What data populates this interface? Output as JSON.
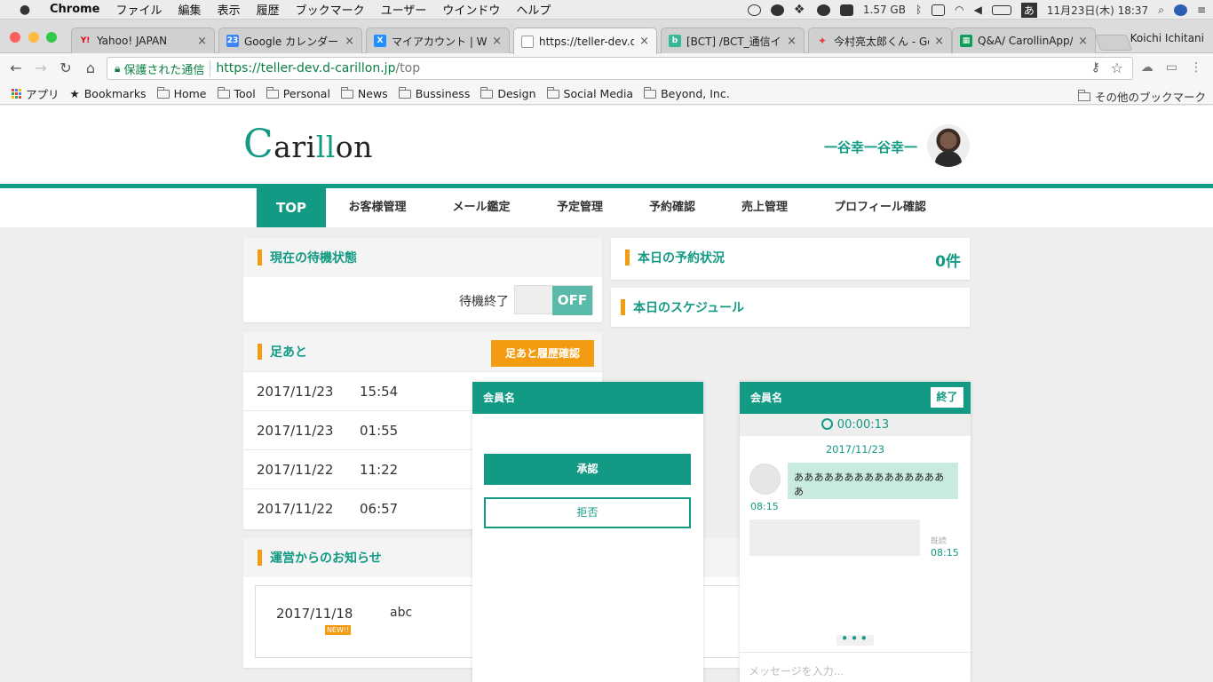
{
  "menubar": {
    "items": [
      "Chrome",
      "ファイル",
      "編集",
      "表示",
      "履歴",
      "ブックマーク",
      "ユーザー",
      "ウインドウ",
      "ヘルプ"
    ],
    "memory": "1.57 GB",
    "ime": "あ",
    "datetime": "11月23日(木)  18:37"
  },
  "tabs": [
    {
      "title": "Yahoo! JAPAN",
      "fav_color": "#e60012",
      "fav_text": "Y!"
    },
    {
      "title": "Google カレンダー - ",
      "fav_color": "#4285f4",
      "fav_text": "23"
    },
    {
      "title": "マイアカウント | Wix",
      "fav_color": "#1e90ff",
      "fav_text": "X"
    },
    {
      "title": "https://teller-dev.d-",
      "fav_color": "#ffffff",
      "fav_text": ""
    },
    {
      "title": "[BCT] /BCT_通信イン",
      "fav_color": "#37b896",
      "fav_text": "b"
    },
    {
      "title": "今村亮太郎くん - Goo",
      "fav_color": "#fbbc05",
      "fav_text": "✦"
    },
    {
      "title": "Q&A/ CarollinApp/",
      "fav_color": "#0f9d58",
      "fav_text": "▦"
    }
  ],
  "profile_name": "Koichi Ichitani",
  "omnibox": {
    "secure_label": "保護された通信",
    "scheme_host": "https://teller-dev.d-carillon.jp",
    "path": "/top"
  },
  "bookmarks": {
    "apps_label": "アプリ",
    "items": [
      "Bookmarks",
      "Home",
      "Tool",
      "Personal",
      "News",
      "Bussiness",
      "Design",
      "Social Media",
      "Beyond, Inc."
    ],
    "other_label": "その他のブックマーク"
  },
  "site": {
    "logo": {
      "c": "C",
      "ari": "ari",
      "ll": "ll",
      "on": "on"
    },
    "username": "一谷幸一谷幸一"
  },
  "nav": [
    "TOP",
    "お客様管理",
    "メール鑑定",
    "予定管理",
    "予約確認",
    "売上管理",
    "プロフィール確認"
  ],
  "standby": {
    "title": "現在の待機状態",
    "label": "待機終了",
    "toggle": "OFF"
  },
  "footprints": {
    "title": "足あと",
    "button": "足あと履歴確認",
    "rows": [
      {
        "date": "2017/11/23",
        "time": "15:54"
      },
      {
        "date": "2017/11/23",
        "time": "01:55"
      },
      {
        "date": "2017/11/22",
        "time": "11:22"
      },
      {
        "date": "2017/11/22",
        "time": "06:57"
      }
    ]
  },
  "notices": {
    "title": "運営からのお知らせ",
    "items": [
      {
        "date": "2017/11/18",
        "text": "abc",
        "badge": "NEW!!"
      }
    ]
  },
  "reservations": {
    "title": "本日の予約状況",
    "count": "0件"
  },
  "schedule": {
    "title": "本日のスケジュール"
  },
  "request_panel": {
    "header": "会員名",
    "approve": "承認",
    "reject": "拒否"
  },
  "chat_panel": {
    "header": "会員名",
    "end_button": "終了",
    "timer": "00:00:13",
    "date": "2017/11/23",
    "incoming": {
      "text": "ああああああああああああああああ",
      "time": "08:15"
    },
    "outgoing": {
      "read": "既読",
      "time": "08:15"
    },
    "typing": "•••",
    "input_placeholder": "メッセージを入力..."
  },
  "colors": {
    "brand": "#139a84",
    "accent": "#f39c12"
  }
}
